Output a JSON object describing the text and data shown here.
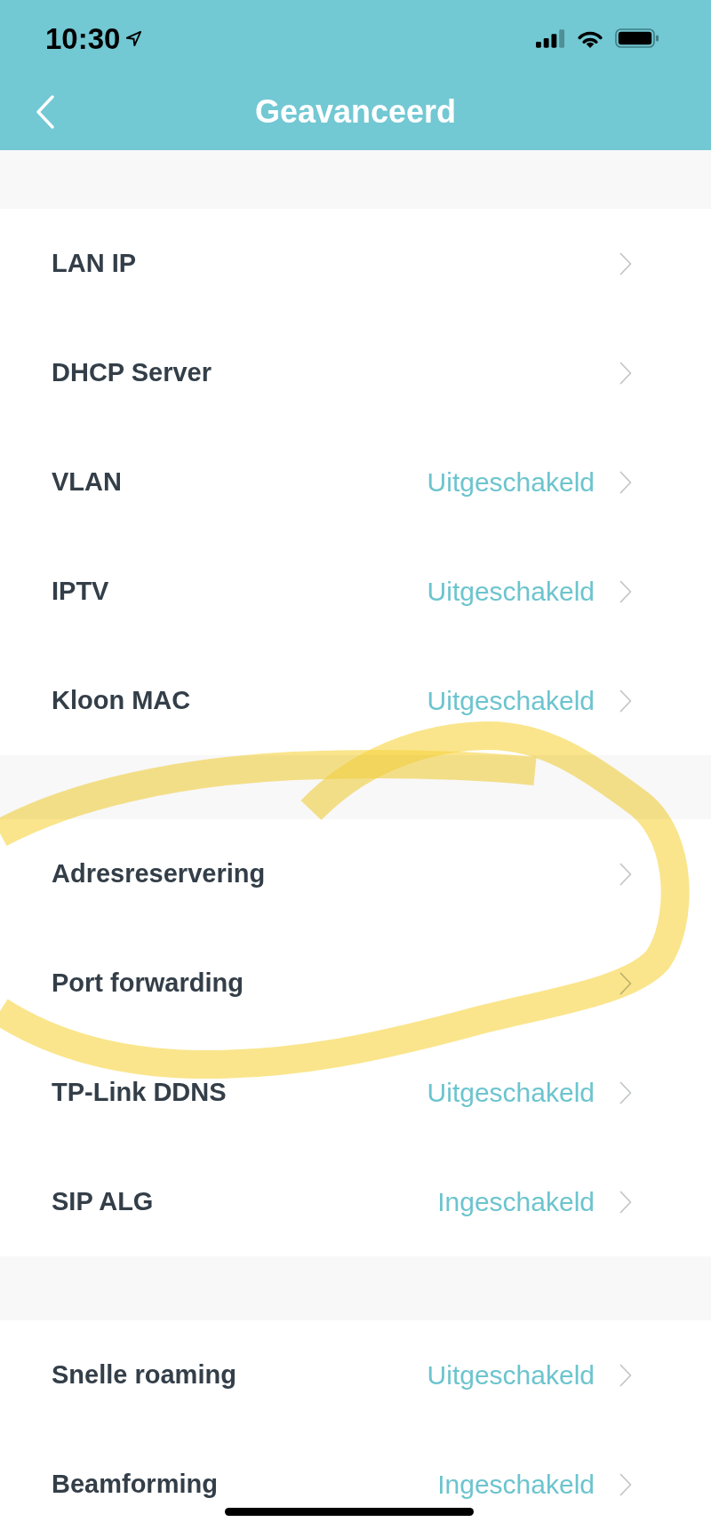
{
  "status_bar": {
    "time": "10:30"
  },
  "nav_bar": {
    "title": "Geavanceerd"
  },
  "sections": [
    {
      "rows": [
        {
          "label": "LAN IP"
        },
        {
          "label": "DHCP Server"
        },
        {
          "label": "VLAN",
          "value": "Uitgeschakeld"
        },
        {
          "label": "IPTV",
          "value": "Uitgeschakeld"
        },
        {
          "label": "Kloon MAC",
          "value": "Uitgeschakeld"
        }
      ]
    },
    {
      "rows": [
        {
          "label": "Adresreservering"
        },
        {
          "label": "Port forwarding"
        },
        {
          "label": "TP-Link DDNS",
          "value": "Uitgeschakeld"
        },
        {
          "label": "SIP ALG",
          "value": "Ingeschakeld"
        }
      ]
    },
    {
      "rows": [
        {
          "label": "Snelle roaming",
          "value": "Uitgeschakeld"
        },
        {
          "label": "Beamforming",
          "value": "Ingeschakeld"
        }
      ]
    }
  ],
  "markup": [
    {
      "kind": "highlighter-loop"
    }
  ]
}
